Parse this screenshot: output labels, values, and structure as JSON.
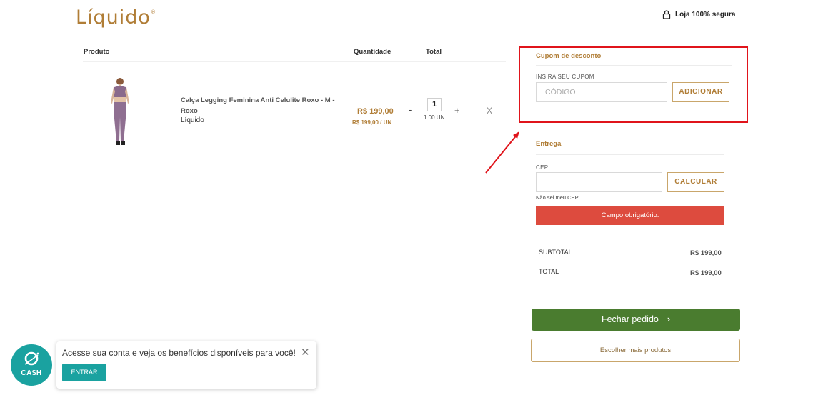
{
  "header": {
    "logo_text": "Líquido",
    "secure_label": "Loja 100% segura",
    "lock_icon": "lock-icon"
  },
  "cart": {
    "headers": {
      "product": "Produto",
      "quantity": "Quantidade",
      "total": "Total"
    },
    "items": [
      {
        "name": "Calça Legging Feminina Anti Celulite Roxo - M - Roxo",
        "brand": "Líquido",
        "price": "R$ 199,00",
        "unit_price": "R$ 199,00 / UN",
        "quantity": "1",
        "quantity_unit": "1.00 UN",
        "decrement": "-",
        "increment": "+",
        "remove": "X"
      }
    ]
  },
  "coupon": {
    "title": "Cupom de desconto",
    "label": "INSIRA SEU CUPOM",
    "placeholder": "CÓDIGO",
    "button": "ADICIONAR"
  },
  "delivery": {
    "title": "Entrega",
    "cep_label": "CEP",
    "cep_value": "",
    "button": "CALCULAR",
    "unknown_cep_link": "Não sei meu CEP",
    "error": "Campo obrigatório."
  },
  "summary": {
    "subtotal_label": "SUBTOTAL",
    "subtotal_value": "R$ 199,00",
    "total_label": "TOTAL",
    "total_value": "R$ 199,00"
  },
  "actions": {
    "checkout": "Fechar pedido",
    "checkout_chevron": "›",
    "continue_shopping": "Escolher mais produtos"
  },
  "cashback": {
    "badge_text": "CA$H",
    "message": "Acesse sua conta e veja os benefícios disponíveis para você!",
    "button": "ENTRAR",
    "close": "✕"
  },
  "colors": {
    "brand_gold": "#b07d36",
    "checkout_green": "#4a7c2f",
    "error_red": "#dd4b3e",
    "annotation_red": "#e0141b",
    "cash_teal": "#1aa2a0"
  }
}
